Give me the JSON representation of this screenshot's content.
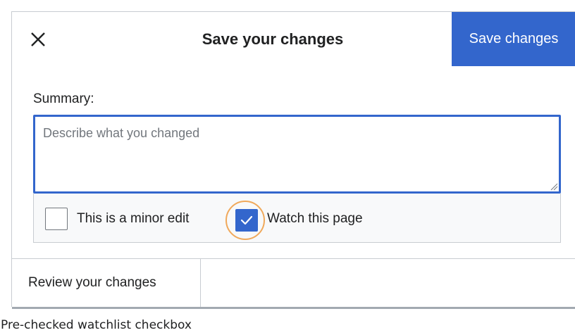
{
  "dialog": {
    "title": "Save your changes",
    "close_icon": "close-icon",
    "save_button_label": "Save changes",
    "summary_label": "Summary:",
    "summary_placeholder": "Describe what you changed",
    "summary_value": "",
    "options": {
      "minor_edit": {
        "label": "This is a minor edit",
        "checked": false
      },
      "watch_page": {
        "label": "Watch this page",
        "checked": true
      }
    },
    "review_button_label": "Review your changes"
  },
  "caption": "Pre-checked watchlist checkbox",
  "colors": {
    "accent": "#3366cc",
    "highlight_ring": "#f0a95b",
    "border": "#c8ccd1",
    "text": "#202122",
    "placeholder": "#72777d"
  }
}
